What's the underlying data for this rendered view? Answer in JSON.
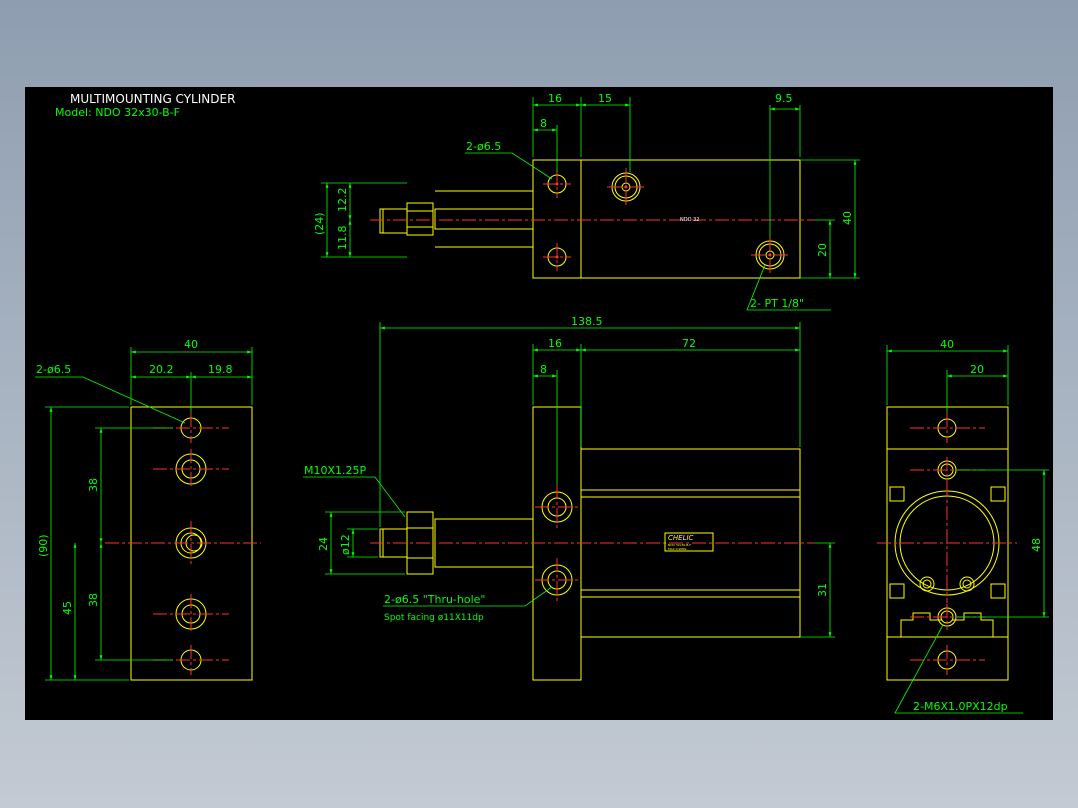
{
  "title": "MULTIMOUNTING CYLINDER",
  "model": "Model: NDO 32x30-B-F",
  "colors": {
    "outline": "#ffff00",
    "dimension": "#00ff00",
    "centerline": "#ff3030",
    "text": "#ffffff",
    "background": "#000000"
  },
  "top_view": {
    "dims": {
      "d16": "16",
      "d15": "15",
      "d9_5": "9.5",
      "d8": "8",
      "d12_2": "12.2",
      "d11_8": "11.8",
      "d24p": "(24)",
      "d40": "40",
      "d20": "20"
    },
    "callout_hole": "2-ø6.5",
    "callout_port": "2- PT 1/8\"",
    "body_label": "NDO 32"
  },
  "left_view": {
    "dims": {
      "d40": "40",
      "d20_2": "20.2",
      "d19_8": "19.8",
      "d38a": "38",
      "d38b": "38",
      "d90p": "(90)",
      "d45": "45"
    },
    "callout_hole": "2-ø6.5"
  },
  "front_view": {
    "dims": {
      "d138_5": "138.5",
      "d16": "16",
      "d72": "72",
      "d8": "8",
      "d24": "24",
      "d12": "ø12",
      "d31": "31"
    },
    "callout_thread": "M10X1.25P",
    "callout_hole": "2-ø6.5 \"Thru-hole\"",
    "callout_spot": "Spot facing  ø11X11dp",
    "logo": "CHELIC",
    "logo_sub1": "NDO 32x30-B-F",
    "logo_sub2": "MAX 0.9MPa"
  },
  "right_view": {
    "dims": {
      "d40": "40",
      "d20": "20",
      "d48": "48"
    },
    "callout_tap": "2-M6X1.0PX12dp"
  }
}
